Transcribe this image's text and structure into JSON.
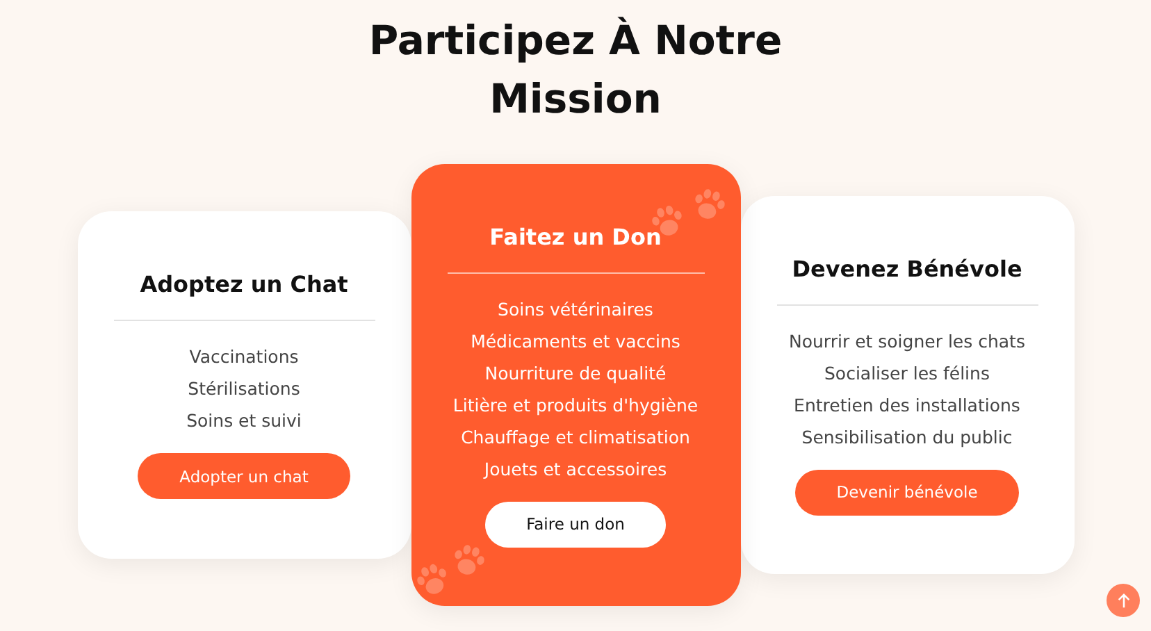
{
  "title": "Participez À Notre Mission",
  "cards": [
    {
      "title": "Adoptez un Chat",
      "featured": false,
      "items": [
        "Vaccinations",
        "Stérilisations",
        "Soins et suivi"
      ],
      "button": "Adopter un chat"
    },
    {
      "title": "Faitez un Don",
      "featured": true,
      "items": [
        "Soins vétérinaires",
        "Médicaments et vaccins",
        "Nourriture de qualité",
        "Litière et produits d'hygiène",
        "Chauffage et climatisation",
        "Jouets et accessoires"
      ],
      "button": "Faire un don"
    },
    {
      "title": "Devenez Bénévole",
      "featured": false,
      "items": [
        "Nourrir et soigner les chats",
        "Socialiser les félins",
        "Entretien des installations",
        "Sensibilisation du public"
      ],
      "button": "Devenir bénévole"
    }
  ]
}
